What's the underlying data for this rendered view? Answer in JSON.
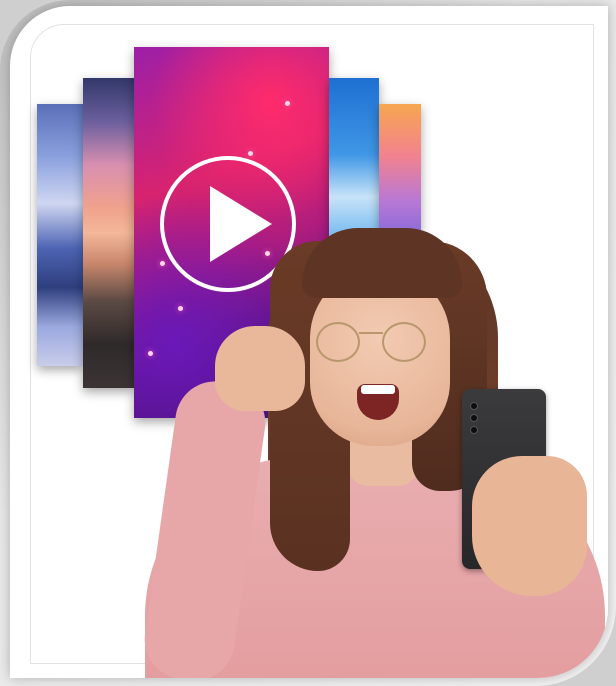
{
  "image": {
    "alt": "",
    "colors": {
      "frame": "#cfcfcf",
      "card": "#ffffff",
      "play_icon": "#ffffff",
      "sweater": "#e7a7a9",
      "hair": "#5e3525",
      "phone": "#2f2f32"
    },
    "icons": [
      "play-icon",
      "smartphone-icon"
    ]
  }
}
